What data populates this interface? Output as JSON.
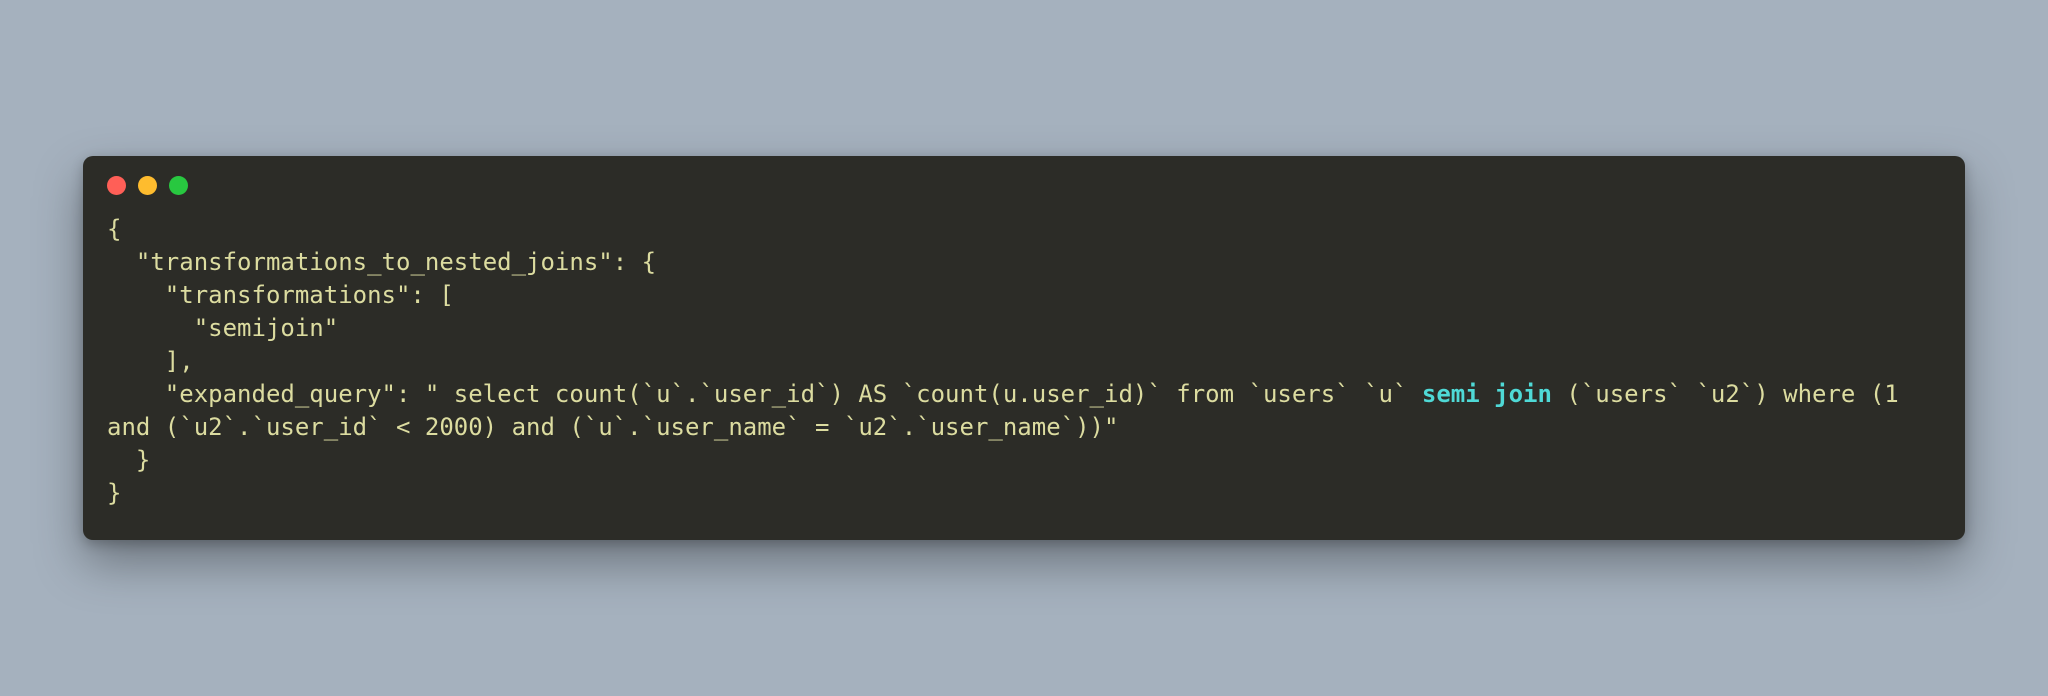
{
  "window": {
    "dot_red": "close-dot",
    "dot_yellow": "minimize-dot",
    "dot_green": "zoom-dot"
  },
  "code": {
    "pre_highlight": "{\n  \"transformations_to_nested_joins\": {\n    \"transformations\": [\n      \"semijoin\"\n    ],\n    \"expanded_query\": \" select count(`u`.`user_id`) AS `count(u.user_id)` from `users` `u` ",
    "highlight": "semi join",
    "post_highlight": " (`users` `u2`) where (1 and (`u2`.`user_id` < 2000) and (`u`.`user_name` = `u2`.`user_name`))\"\n  }\n}"
  }
}
